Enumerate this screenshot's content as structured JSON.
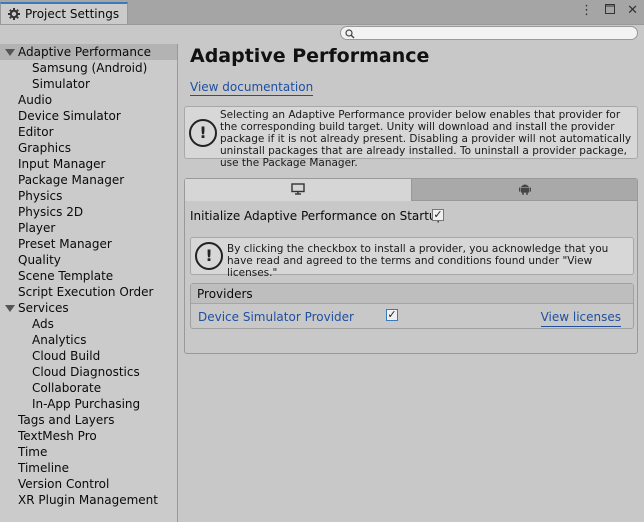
{
  "window": {
    "tab_title": "Project Settings",
    "icons": [
      "gear-icon",
      "more-icon",
      "maximize-icon",
      "close-icon"
    ]
  },
  "search": {
    "placeholder": ""
  },
  "sidebar": {
    "items": [
      {
        "label": "Adaptive Performance",
        "indent": 0,
        "expanded": true,
        "selected": true
      },
      {
        "label": "Samsung (Android)",
        "indent": 1
      },
      {
        "label": "Simulator",
        "indent": 1
      },
      {
        "label": "Audio",
        "indent": 0
      },
      {
        "label": "Device Simulator",
        "indent": 0
      },
      {
        "label": "Editor",
        "indent": 0
      },
      {
        "label": "Graphics",
        "indent": 0
      },
      {
        "label": "Input Manager",
        "indent": 0
      },
      {
        "label": "Package Manager",
        "indent": 0
      },
      {
        "label": "Physics",
        "indent": 0
      },
      {
        "label": "Physics 2D",
        "indent": 0
      },
      {
        "label": "Player",
        "indent": 0
      },
      {
        "label": "Preset Manager",
        "indent": 0
      },
      {
        "label": "Quality",
        "indent": 0
      },
      {
        "label": "Scene Template",
        "indent": 0
      },
      {
        "label": "Script Execution Order",
        "indent": 0
      },
      {
        "label": "Services",
        "indent": 0,
        "expanded": true
      },
      {
        "label": "Ads",
        "indent": 1
      },
      {
        "label": "Analytics",
        "indent": 1
      },
      {
        "label": "Cloud Build",
        "indent": 1
      },
      {
        "label": "Cloud Diagnostics",
        "indent": 1
      },
      {
        "label": "Collaborate",
        "indent": 1
      },
      {
        "label": "In-App Purchasing",
        "indent": 1
      },
      {
        "label": "Tags and Layers",
        "indent": 0
      },
      {
        "label": "TextMesh Pro",
        "indent": 0
      },
      {
        "label": "Time",
        "indent": 0
      },
      {
        "label": "Timeline",
        "indent": 0
      },
      {
        "label": "Version Control",
        "indent": 0
      },
      {
        "label": "XR Plugin Management",
        "indent": 0
      }
    ]
  },
  "main": {
    "title": "Adaptive Performance",
    "doc_link": "View documentation",
    "info_text": "Selecting an Adaptive Performance provider below enables that provider for the corresponding build target. Unity will download and install the provider package if it is not already present. Disabling a provider will not automatically uninstall packages that are already installed. To uninstall a provider package, use the Package Manager.",
    "platform_tabs": [
      {
        "icon": "desktop-icon",
        "active": true
      },
      {
        "icon": "android-icon",
        "active": false
      }
    ],
    "startup_label": "Initialize Adaptive Performance on Startup",
    "startup_checked": true,
    "license_text": "By clicking the checkbox to install a provider, you acknowledge that you have read and agreed to the terms and conditions found under \"View licenses.\"",
    "providers_header": "Providers",
    "provider_name": "Device Simulator Provider",
    "provider_checked": true,
    "licenses_link": "View licenses"
  }
}
